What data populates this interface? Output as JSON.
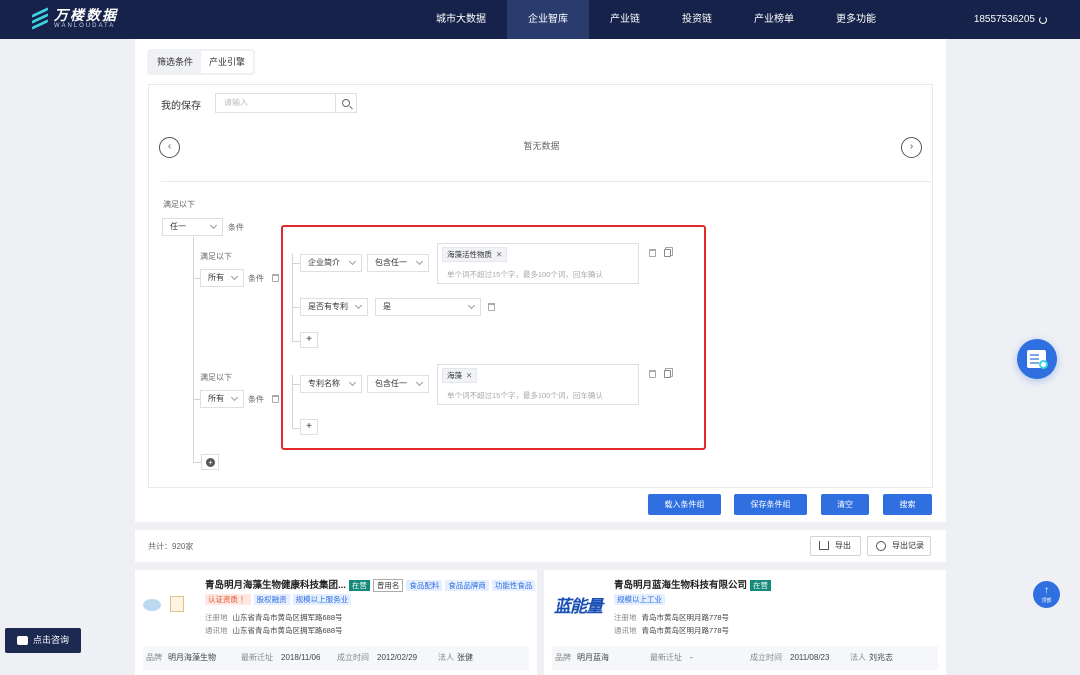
{
  "brand": {
    "cn": "万楼数据",
    "en": "WANLOUDATA"
  },
  "nav": [
    "城市大数据",
    "企业智库",
    "产业链",
    "投资链",
    "产业榜单",
    "更多功能"
  ],
  "user": {
    "phone": "18557536205"
  },
  "tabs": [
    "筛选条件",
    "产业引擎"
  ],
  "saved": {
    "label": "我的保存",
    "placeholder": "请输入",
    "empty": "暂无数据"
  },
  "builder": {
    "satisfy": "满足以下",
    "cond": "条件",
    "root_select": "任一",
    "group1": {
      "select": "所有",
      "rule1": {
        "field": "企业简介",
        "op": "包含任一",
        "tag": "海藻活性物质",
        "hint": "单个词不超过15个字，最多100个词，回车确认"
      },
      "rule2": {
        "field": "是否有专利",
        "value": "是"
      }
    },
    "group2": {
      "select": "所有",
      "rule1": {
        "field": "专利名称",
        "op": "包含任一",
        "tag": "海藻",
        "hint": "单个词不超过15个字，最多100个词，回车确认"
      }
    },
    "plus": "+"
  },
  "actions": {
    "load": "载入条件组",
    "save": "保存条件组",
    "clear": "清空",
    "search": "搜索"
  },
  "results": {
    "total": "共计：920家",
    "export": "导出",
    "export_log": "导出记录"
  },
  "companies": [
    {
      "name": "青岛明月海藻生物健康科技集团...",
      "status": "在营",
      "badges": [
        "曾用名",
        "食品配料",
        "食品品牌商",
        "功能性食品"
      ],
      "chips": [
        "认证资质 ！",
        "股权融资",
        "规模以上服务业"
      ],
      "reg_label": "注册地",
      "reg": "山东省青岛市黄岛区拥军路688号",
      "mail_label": "通讯地",
      "mail": "山东省青岛市黄岛区拥军路688号",
      "brand_label": "品牌",
      "brand": "明月海藻生物",
      "move_label": "最新迁址",
      "move": "2018/11/06",
      "found_label": "成立时间",
      "found": "2012/02/29",
      "legal_label": "法人",
      "legal": "张健"
    },
    {
      "name": "青岛明月蓝海生物科技有限公司",
      "status": "在营",
      "logo_text": "蓝能量",
      "chips": [
        "规模以上工业"
      ],
      "reg_label": "注册地",
      "reg": "青岛市黄岛区明月路778号",
      "mail_label": "通讯地",
      "mail": "青岛市黄岛区明月路778号",
      "brand_label": "品牌",
      "brand": "明月蓝海",
      "move_label": "最新迁址",
      "move": "-",
      "found_label": "成立时间",
      "found": "2011/08/23",
      "legal_label": "法人",
      "legal": "刘兆志"
    }
  ],
  "floating": {
    "consult": "点击咨询",
    "top": "顶部",
    "top_arrow": "↑"
  },
  "colors": {
    "nav_bg": "#16224a",
    "primary": "#2f6fe0",
    "status_green": "#138a7a",
    "highlight_red": "#e22a2a"
  }
}
